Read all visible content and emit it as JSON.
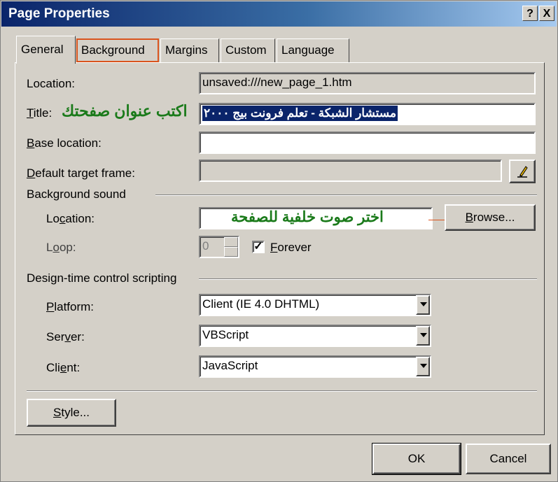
{
  "window": {
    "title": "Page Properties",
    "help_button": "?",
    "close_button": "X"
  },
  "tabs": [
    {
      "label": "General",
      "active": true
    },
    {
      "label": "Background",
      "active": false
    },
    {
      "label": "Margins",
      "active": false
    },
    {
      "label": "Custom",
      "active": false
    },
    {
      "label": "Language",
      "active": false
    }
  ],
  "general": {
    "location_label": "Location:",
    "location_value": "unsaved:///new_page_1.htm",
    "title_label_prefix": "T",
    "title_label_rest": "itle:",
    "title_annotation": "اكتب عنوان صفحتك",
    "title_value": "مستشار الشبكة - تعلم فرونت بيج ٢٠٠٠",
    "base_location_label_prefix": "B",
    "base_location_label_rest": "ase location:",
    "base_location_value": "",
    "default_target_label_prefix": "D",
    "default_target_label_rest": "efault target frame:",
    "default_target_value": ""
  },
  "background_sound": {
    "group_label": "Background sound",
    "location_label_a": "Lo",
    "location_label_u": "c",
    "location_label_b": "ation:",
    "location_value": "اختر صوت خلفية للصفحة",
    "browse_label_u": "B",
    "browse_label_rest": "rowse...",
    "loop_label_a": "L",
    "loop_label_u": "o",
    "loop_label_b": "op:",
    "loop_value": "0",
    "forever_checked": true,
    "forever_check_glyph": "✓",
    "forever_label_u": "F",
    "forever_label_rest": "orever"
  },
  "scripting": {
    "group_label": "Design-time control scripting",
    "platform_label_u": "P",
    "platform_label_rest": "latform:",
    "platform_value": "Client (IE 4.0 DHTML)",
    "server_label_a": "Ser",
    "server_label_u": "v",
    "server_label_b": "er:",
    "server_value": "VBScript",
    "client_label_a": "Cli",
    "client_label_u": "e",
    "client_label_b": "nt:",
    "client_value": "JavaScript"
  },
  "buttons": {
    "style_u": "S",
    "style_rest": "tyle...",
    "ok": "OK",
    "cancel": "Cancel"
  },
  "colors": {
    "annotation_green": "#1a7a1a",
    "highlight_blue": "#0a246a",
    "callout_red": "#d9541e"
  }
}
